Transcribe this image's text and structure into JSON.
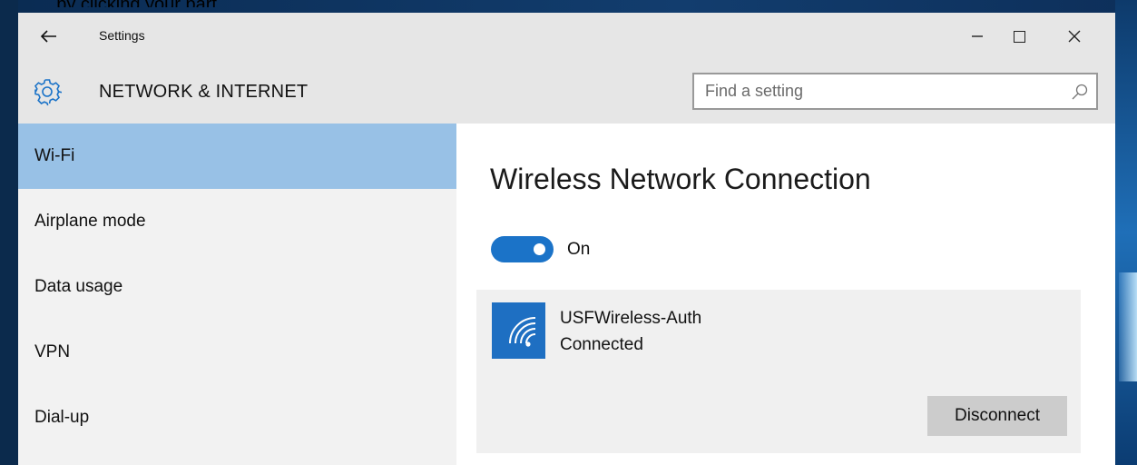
{
  "desktop": {
    "caption": "... by clicking your part"
  },
  "titlebar": {
    "title": "Settings",
    "back_icon": "back-arrow-icon",
    "minimize_icon": "minimize-icon",
    "maximize_icon": "maximize-icon",
    "close_icon": "close-icon"
  },
  "header": {
    "section_title": "NETWORK & INTERNET",
    "section_icon": "gear-icon",
    "search": {
      "placeholder": "Find a setting",
      "icon": "search-icon"
    }
  },
  "sidebar": {
    "items": [
      {
        "label": "Wi-Fi",
        "active": true
      },
      {
        "label": "Airplane mode",
        "active": false
      },
      {
        "label": "Data usage",
        "active": false
      },
      {
        "label": "VPN",
        "active": false
      },
      {
        "label": "Dial-up",
        "active": false
      }
    ]
  },
  "content": {
    "title": "Wireless Network Connection",
    "toggle": {
      "state_label": "On",
      "on": true
    },
    "network": {
      "name": "USFWireless-Auth",
      "status": "Connected",
      "icon": "wifi-icon",
      "disconnect_label": "Disconnect"
    }
  },
  "colors": {
    "accent": "#1b73c8",
    "selected_nav": "#98c1e6",
    "chrome": "#e6e6e6",
    "sidebar_bg": "#f2f2f2",
    "button_bg": "#cccccc"
  }
}
